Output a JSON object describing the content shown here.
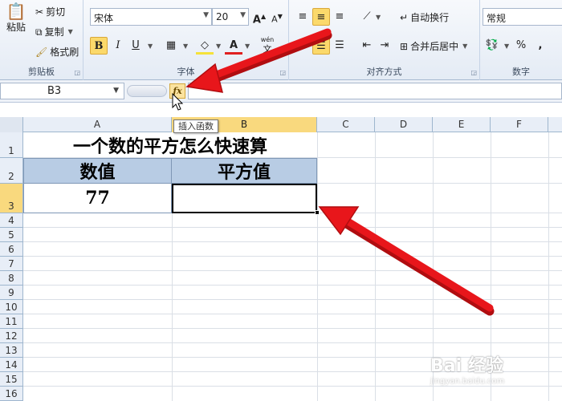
{
  "ribbon": {
    "clipboard": {
      "label": "剪贴板",
      "paste": "粘贴",
      "cut": "剪切",
      "copy": "复制",
      "format_painter": "格式刷"
    },
    "font": {
      "label": "字体",
      "font_name": "宋体",
      "font_size": "20",
      "bold": "B",
      "italic": "I",
      "underline": "U",
      "phonetic": "wén"
    },
    "alignment": {
      "label": "对齐方式",
      "wrap_text": "自动换行",
      "merge_center": "合并后居中"
    },
    "number": {
      "label": "数字",
      "format": "常规",
      "percent": "%",
      "comma": ","
    }
  },
  "formula_bar": {
    "name_box": "B3",
    "fx_label": "fx",
    "fx_tooltip": "插入函数"
  },
  "sheet": {
    "columns": [
      "A",
      "B",
      "C",
      "D",
      "E",
      "F"
    ],
    "rows": [
      "1",
      "2",
      "3",
      "4",
      "5",
      "6",
      "7",
      "8",
      "9",
      "10",
      "11",
      "12",
      "13",
      "14",
      "15",
      "16"
    ],
    "title": "一个数的平方怎么快速算",
    "header_a": "数值",
    "header_b": "平方值",
    "value_a": "77",
    "value_b": "",
    "selected_cell": "B3"
  },
  "watermark": {
    "brand": "Bai 经验",
    "url": "jingyan.baidu.com"
  },
  "colors": {
    "header_fill": "#b8cce4",
    "selection_highlight": "#f9d97e",
    "arrow": "#e8161b"
  }
}
